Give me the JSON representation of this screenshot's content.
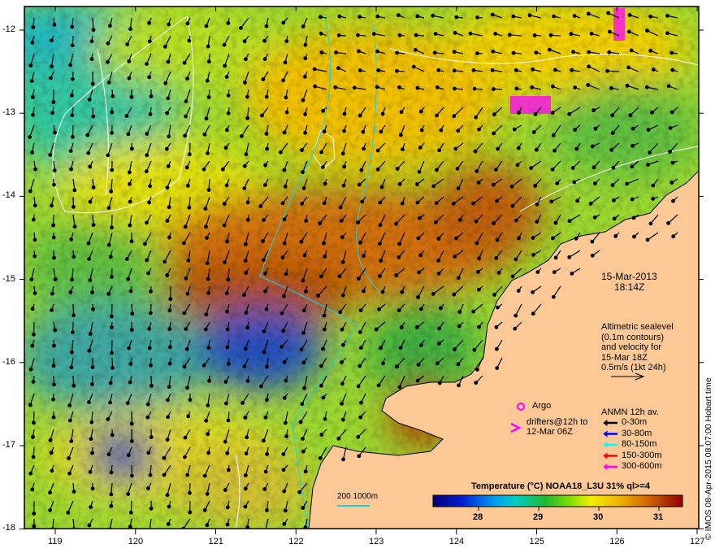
{
  "map": {
    "date": "15-Mar-2013",
    "time": "18:14Z",
    "altimetry_text": [
      "Altimetric sealevel",
      "(0.1m contours)",
      "and velocity for",
      "15-Mar 18Z",
      "0.5m/s (1kt 24h)"
    ],
    "argo_label": "Argo",
    "drifters_label": [
      "drifters@12h to",
      "12-Mar 06Z"
    ],
    "anmn_title": "ANMN 12h av.",
    "anmn_legend": [
      {
        "label": "0-30m",
        "color": "#000000"
      },
      {
        "label": "30-80m",
        "color": "#0000ff"
      },
      {
        "label": "80-150m",
        "color": "#00ffff"
      },
      {
        "label": "150-300m",
        "color": "#ff0000"
      },
      {
        "label": "300-600m",
        "color": "#ff00ff"
      }
    ],
    "scale_bar_label": "200  1000m",
    "credit": "© IMOS 08-Apr-2015 08:07:00 Hobart time",
    "colorbar": {
      "title": "Temperature (°C) NOAA18_L3U 31% ql>=4",
      "ticks": [
        "28",
        "29",
        "30",
        "31"
      ],
      "min": 27.25,
      "max": 31.4
    },
    "x_ticks": [
      "119",
      "120",
      "121",
      "122",
      "123",
      "124",
      "125",
      "126",
      "127"
    ],
    "y_ticks": [
      "-12",
      "-13",
      "-14",
      "-15",
      "-16",
      "-17",
      "-18"
    ],
    "colors": {
      "land": "#fcc896",
      "argo": "#ff00ff"
    }
  }
}
